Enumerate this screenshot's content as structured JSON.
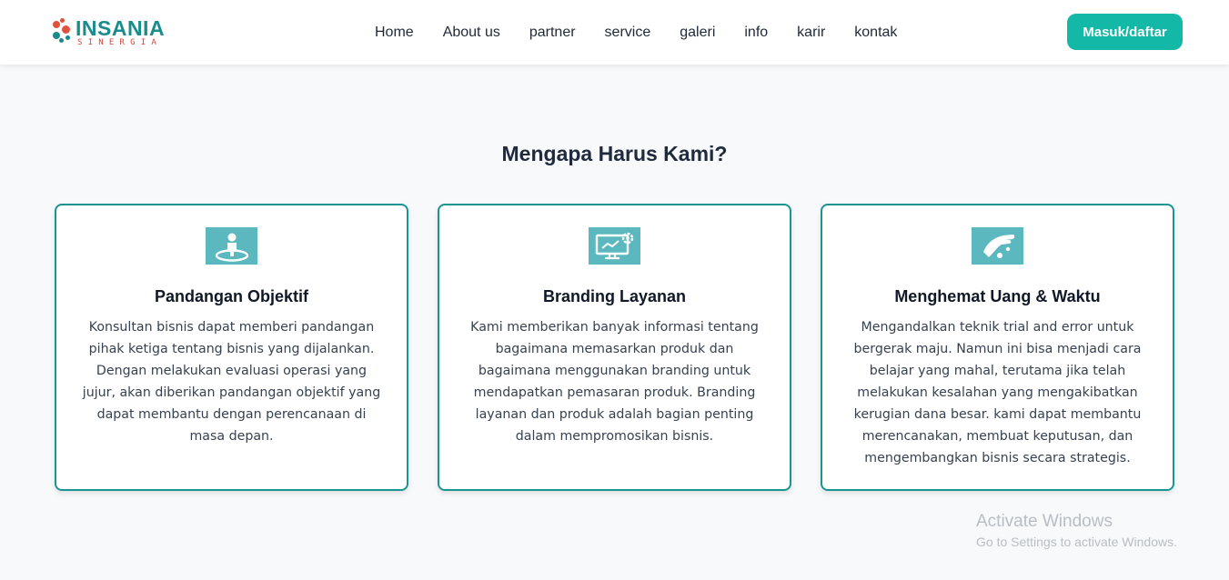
{
  "header": {
    "logo": {
      "main_text": "INSANIA",
      "sub_text": "SINERGIA"
    },
    "nav": [
      {
        "label": "Home"
      },
      {
        "label": "About us"
      },
      {
        "label": "partner"
      },
      {
        "label": "service"
      },
      {
        "label": "galeri"
      },
      {
        "label": "info"
      },
      {
        "label": "karir"
      },
      {
        "label": "kontak"
      }
    ],
    "login_label": "Masuk/daftar"
  },
  "section": {
    "title": "Mengapa Harus Kami?",
    "cards": [
      {
        "icon": "person-target-icon",
        "title": "Pandangan Objektif",
        "text": "Konsultan bisnis dapat memberi pandangan pihak ketiga tentang bisnis yang dijalankan. Dengan melakukan evaluasi operasi yang jujur, akan diberikan pandangan objektif yang dapat membantu dengan perencanaan di masa depan."
      },
      {
        "icon": "monitor-gear-icon",
        "title": "Branding Layanan",
        "text": "Kami memberikan banyak informasi tentang bagaimana memasarkan produk dan bagaimana menggunakan branding untuk mendapatkan pemasaran produk. Branding layanan dan produk adalah bagian penting dalam mempromosikan bisnis."
      },
      {
        "icon": "hand-coin-icon",
        "title": "Menghemat Uang & Waktu",
        "text": "Mengandalkan teknik trial and error untuk bergerak maju. Namun ini bisa menjadi cara belajar yang mahal, terutama jika telah melakukan kesalahan yang mengakibatkan kerugian dana besar. kami dapat membantu merencanakan, membuat keputusan, dan mengembangkan bisnis secara strategis."
      }
    ]
  },
  "watermark": {
    "title": "Activate Windows",
    "subtitle": "Go to Settings to activate Windows."
  },
  "colors": {
    "accent": "#14b8a6",
    "card_border": "#1a9490",
    "icon_bg": "#5bb8bf",
    "logo_teal": "#1a8c8c",
    "logo_red": "#d2463c"
  }
}
